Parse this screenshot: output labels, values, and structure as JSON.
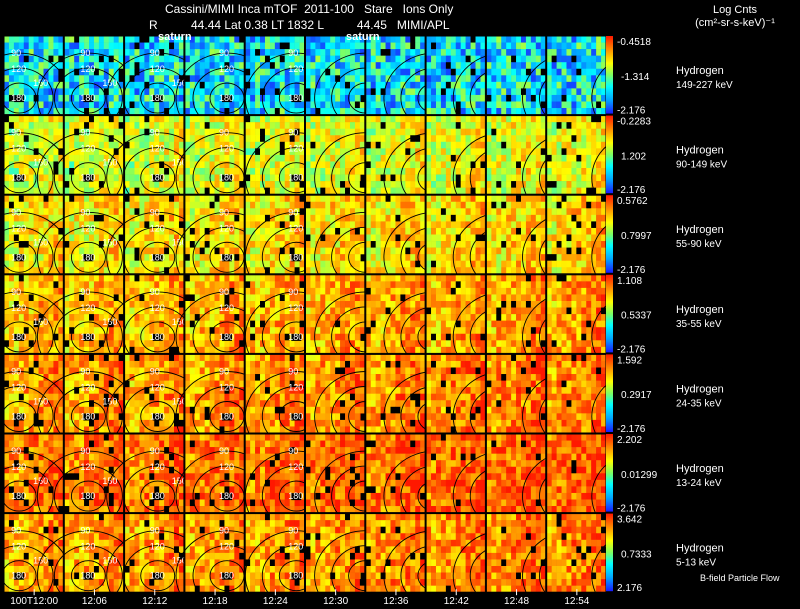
{
  "header": {
    "title": "Cassini/MIMI Inca mTOF  2011-100   Stare   Ions Only",
    "subtitle": "R          44.44 Lat 0.38 LT 1832 L          44.45   MIMI/APL",
    "unit_line1": "Log Cnts",
    "unit_line2": "(cm²-sr-s-keV)⁻¹",
    "footer_note": "B-field Particle Flow"
  },
  "chart_data": {
    "type": "heatmap",
    "description_layout": "7 energy-channel rows x 10 time columns of sky-map images",
    "time_ticks": [
      "100T12:00",
      "12:06",
      "12:12",
      "12:18",
      "12:24",
      "12:30",
      "12:36",
      "12:42",
      "12:48",
      "12:54"
    ],
    "panel_annotations": [
      "saturn",
      "saturn"
    ],
    "contour_labels": [
      "90",
      "120",
      "150",
      "180"
    ],
    "channels": [
      {
        "species": "Hydrogen",
        "energy": "149-227 keV",
        "max": "-0.4518",
        "mid": "-1.314",
        "min": "-2.176",
        "level": 0.3
      },
      {
        "species": "Hydrogen",
        "energy": "90-149 keV",
        "max": "-0.2283",
        "mid": "1.202",
        "min": "-2.176",
        "level": 0.55
      },
      {
        "species": "Hydrogen",
        "energy": "55-90 keV",
        "max": "0.5762",
        "mid": "0.7997",
        "min": "-2.176",
        "level": 0.62
      },
      {
        "species": "Hydrogen",
        "energy": "35-55 keV",
        "max": "1.108",
        "mid": "0.5337",
        "min": "-2.176",
        "level": 0.7
      },
      {
        "species": "Hydrogen",
        "energy": "24-35 keV",
        "max": "1.592",
        "mid": "0.2917",
        "min": "-2.176",
        "level": 0.74
      },
      {
        "species": "Hydrogen",
        "energy": "13-24 keV",
        "max": "2.202",
        "mid": "0.01299",
        "min": "-2.176",
        "level": 0.8
      },
      {
        "species": "Hydrogen",
        "energy": "5-13 keV",
        "max": "3.642",
        "mid": "0.7333",
        "min": "2.176",
        "level": 0.74
      }
    ]
  }
}
